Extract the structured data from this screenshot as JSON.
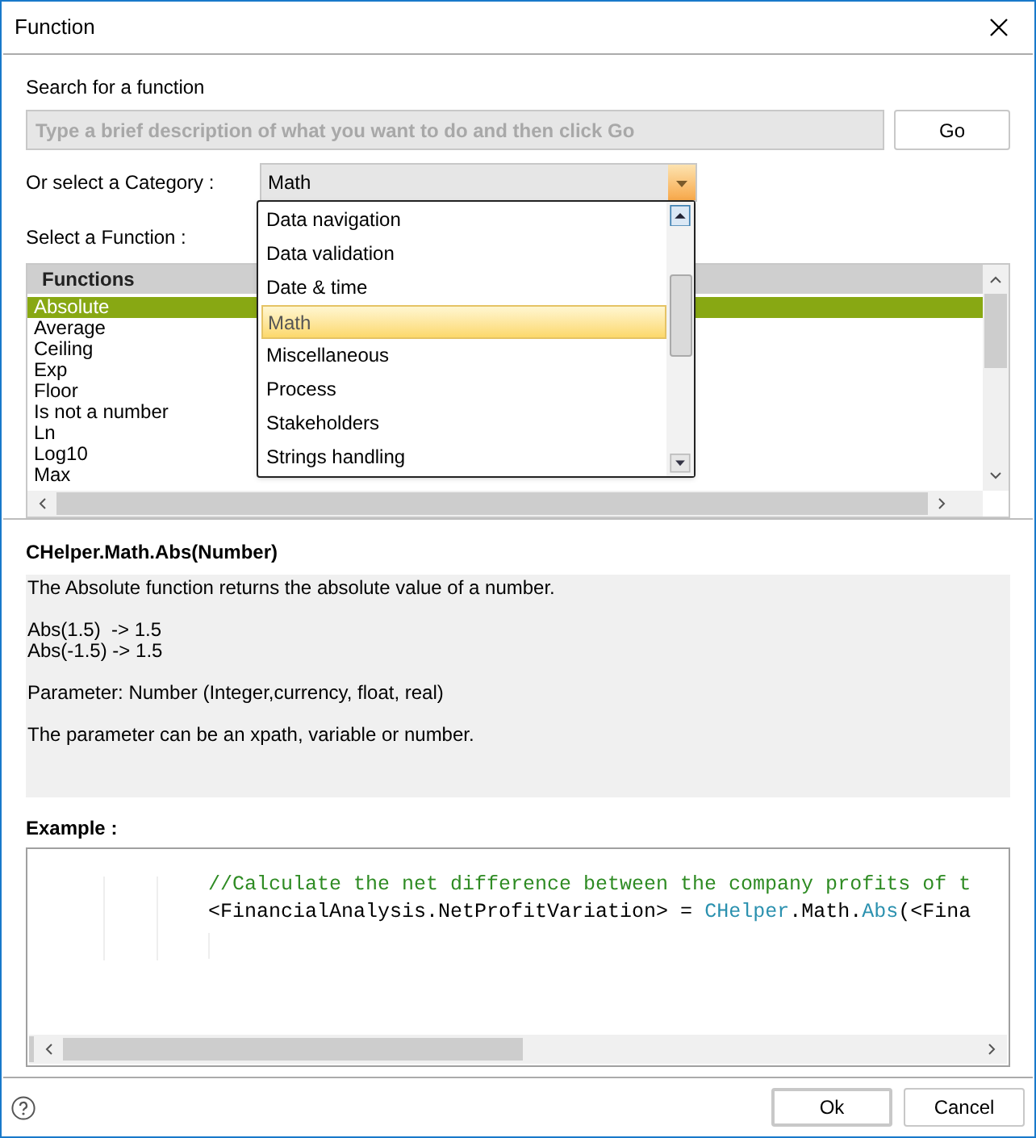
{
  "window": {
    "title": "Function"
  },
  "search": {
    "label": "Search for a function",
    "placeholder": "Type a brief description of what you want to do and then click Go",
    "button": "Go"
  },
  "category": {
    "label": "Or select a Category :",
    "value": "Math",
    "options": [
      {
        "label": "Data navigation",
        "selected": false
      },
      {
        "label": "Data validation",
        "selected": false
      },
      {
        "label": "Date & time",
        "selected": false
      },
      {
        "label": "Math",
        "selected": true
      },
      {
        "label": "Miscellaneous",
        "selected": false
      },
      {
        "label": "Process",
        "selected": false
      },
      {
        "label": "Stakeholders",
        "selected": false
      },
      {
        "label": "Strings handling",
        "selected": false
      }
    ]
  },
  "functions": {
    "label": "Select a Function :",
    "column": "Functions",
    "rows": [
      {
        "name": "Absolute",
        "selected": true
      },
      {
        "name": "Average",
        "selected": false
      },
      {
        "name": "Ceiling",
        "selected": false
      },
      {
        "name": "Exp",
        "selected": false
      },
      {
        "name": "Floor",
        "selected": false
      },
      {
        "name": "Is not a number",
        "selected": false
      },
      {
        "name": "Ln",
        "selected": false
      },
      {
        "name": "Log10",
        "selected": false
      },
      {
        "name": "Max",
        "selected": false
      }
    ]
  },
  "signature": "CHelper.Math.Abs(Number)",
  "description": [
    [
      "The Absolute function returns the absolute value of a number."
    ],
    [
      "Abs(1.5)  -> 1.5",
      "Abs(-1.5) -> 1.5"
    ],
    [
      "Parameter: Number (Integer,currency, float, real)"
    ],
    [
      "The parameter can be an xpath, variable or number."
    ]
  ],
  "example": {
    "label": "Example :",
    "lines": [
      [
        {
          "kind": "comment",
          "text": "//Calculate the net difference between the company profits of t"
        }
      ],
      [
        {
          "kind": "plain",
          "text": "<FinancialAnalysis.NetProfitVariation> = "
        },
        {
          "kind": "type",
          "text": "CHelper"
        },
        {
          "kind": "plain",
          "text": ".Math."
        },
        {
          "kind": "type",
          "text": "Abs"
        },
        {
          "kind": "plain",
          "text": "(<Fina"
        }
      ]
    ]
  },
  "buttons": [
    {
      "label": "Ok",
      "default": true
    },
    {
      "label": "Cancel",
      "default": false
    }
  ]
}
